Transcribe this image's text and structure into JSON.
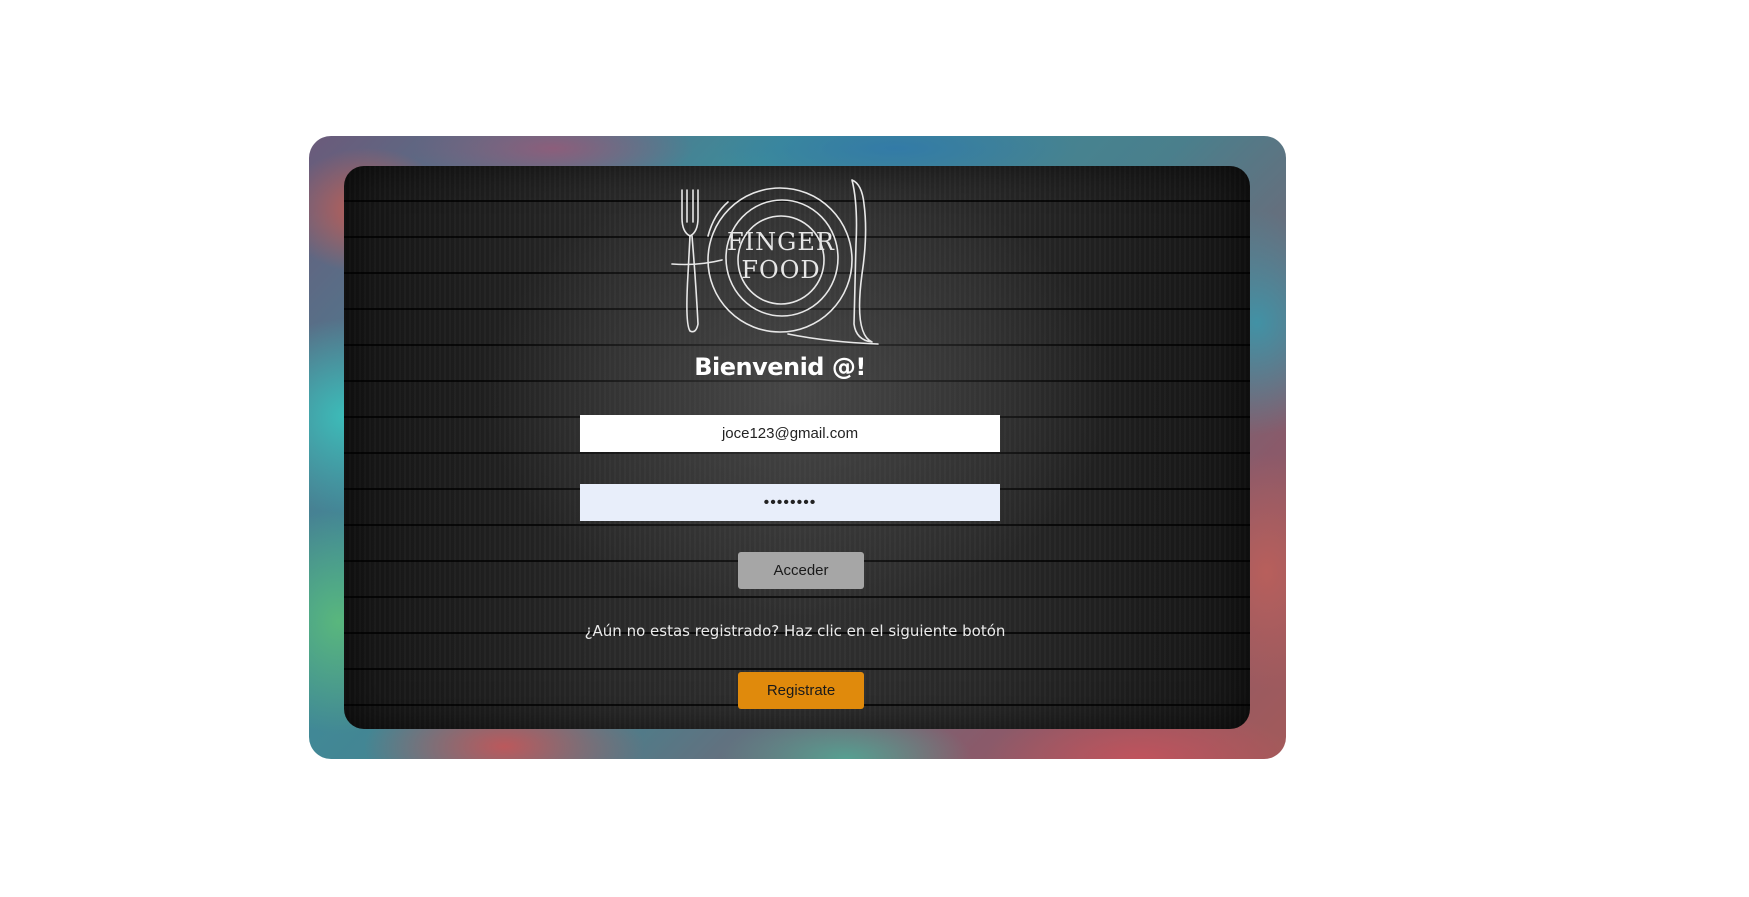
{
  "logo": {
    "line1": "FINGER",
    "line2": "FOOD",
    "icon": "fork-plate-knife-icon"
  },
  "welcome_title": "Bienvenid @!",
  "login_form": {
    "email_value": "joce123@gmail.com",
    "password_value": "••••••••",
    "access_button_label": "Acceder"
  },
  "register": {
    "hint_text": "¿Aún no estas registrado? Haz clic en el siguiente botón",
    "button_label": "Registrate"
  },
  "colors": {
    "access_button": "#a6a6a6",
    "register_button": "#e08a0c",
    "password_field_bg": "#e8eefa",
    "panel_bg": "#2a2a2a"
  }
}
